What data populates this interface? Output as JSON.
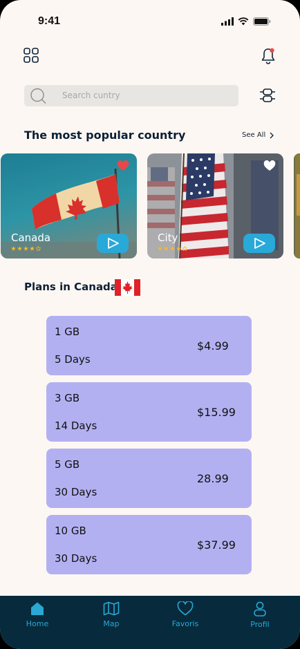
{
  "status": {
    "time": "9:41"
  },
  "search": {
    "placeholder": "Search cuntry"
  },
  "popular": {
    "title": "The most popular country",
    "see_all": "See All",
    "cards": [
      {
        "name": "Canada",
        "rating": 4,
        "favorite": true,
        "heart_color": "#e94848"
      },
      {
        "name": "City",
        "rating": 4,
        "favorite": false,
        "heart_color": "#ffffff"
      }
    ]
  },
  "plans": {
    "title": "Plans in Canada",
    "items": [
      {
        "data": "1 GB",
        "duration": "5 Days",
        "price": "$4.99"
      },
      {
        "data": "3 GB",
        "duration": "14 Days",
        "price": "$15.99"
      },
      {
        "data": "5 GB",
        "duration": "30 Days",
        "price": "28.99"
      },
      {
        "data": "10 GB",
        "duration": "30 Days",
        "price": "$37.99"
      }
    ]
  },
  "nav": {
    "items": [
      {
        "label": "Home",
        "icon": "home-icon"
      },
      {
        "label": "Map",
        "icon": "map-icon"
      },
      {
        "label": "Favoris",
        "icon": "heart-icon"
      },
      {
        "label": "Profil",
        "icon": "user-icon"
      }
    ]
  },
  "colors": {
    "accent": "#29a9d8",
    "plan_card": "#b3b0f2",
    "nav_bg": "#072b3d",
    "text_dark": "#0b2035"
  }
}
